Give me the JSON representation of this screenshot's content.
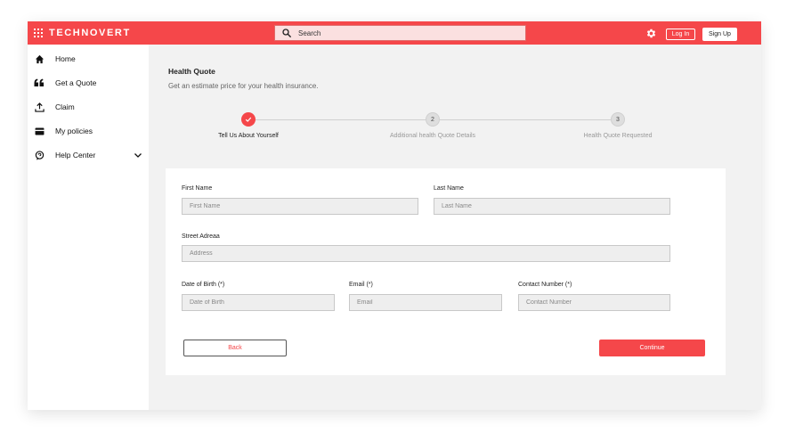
{
  "app": {
    "brand": "TECHNOVERT",
    "search_placeholder": "Search",
    "login_label": "Log In",
    "signup_label": "Sign Up",
    "accent_color": "#f5474a"
  },
  "sidebar": {
    "items": [
      {
        "label": "Home",
        "icon": "home-icon"
      },
      {
        "label": "Get a Quote",
        "icon": "quote-icon"
      },
      {
        "label": "Claim",
        "icon": "upload-icon"
      },
      {
        "label": "My policies",
        "icon": "card-icon"
      },
      {
        "label": "Help Center",
        "icon": "help-icon"
      }
    ]
  },
  "page": {
    "title": "Health Quote",
    "subtitle": "Get an estimate price for your health insurance."
  },
  "stepper": {
    "steps": [
      {
        "number": "1",
        "label": "Tell Us About Yourself",
        "status": "completed"
      },
      {
        "number": "2",
        "label": "Additional health Quote Details",
        "status": "pending"
      },
      {
        "number": "3",
        "label": "Health Quote Requested",
        "status": "pending"
      }
    ]
  },
  "form": {
    "first_name": {
      "label": "First Name",
      "placeholder": "First Name"
    },
    "last_name": {
      "label": "Last Name",
      "placeholder": "Last Name"
    },
    "street": {
      "label": "Street Adreaa",
      "placeholder": "Address"
    },
    "dob": {
      "label": "Date of Birth (*)",
      "placeholder": "Date of Birth"
    },
    "email": {
      "label": "Email (*)",
      "placeholder": "Email"
    },
    "contact": {
      "label": "Contact Number (*)",
      "placeholder": "Contact Number"
    },
    "back_label": "Back",
    "continue_label": "Continue"
  }
}
